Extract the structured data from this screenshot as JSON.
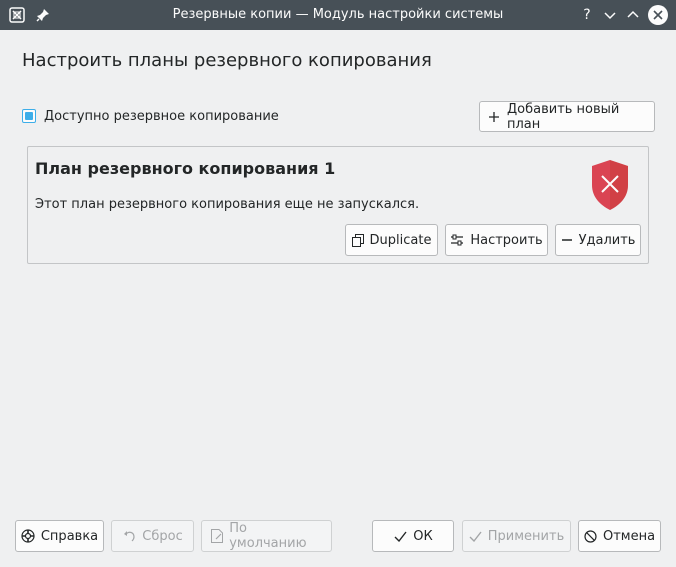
{
  "window": {
    "title": "Резервные копии — Модуль настройки системы",
    "colors": {
      "titlebar": "#475057",
      "accent": "#3daee9",
      "error": "#da4453"
    },
    "icons": [
      "app-icon",
      "pin-icon",
      "help-icon",
      "minimize-icon",
      "maximize-icon",
      "close-icon"
    ],
    "help_glyph": "?"
  },
  "page": {
    "heading": "Настроить планы резервного копирования"
  },
  "backup_enabled": {
    "label": "Доступно резервное копирование",
    "checked": true
  },
  "add_plan_button": {
    "label": "Добавить новый план"
  },
  "plan": {
    "title": "План резервного копирования 1",
    "status": "Этот план резервного копирования еще не запускался.",
    "status_icon": "error-shield-icon",
    "buttons": {
      "duplicate": "Duplicate",
      "configure": "Настроить",
      "remove": "Удалить"
    }
  },
  "footer": {
    "help": "Справка",
    "reset": "Сброс",
    "defaults": "По умолчанию",
    "ok": "ОК",
    "apply": "Применить",
    "cancel": "Отмена"
  }
}
